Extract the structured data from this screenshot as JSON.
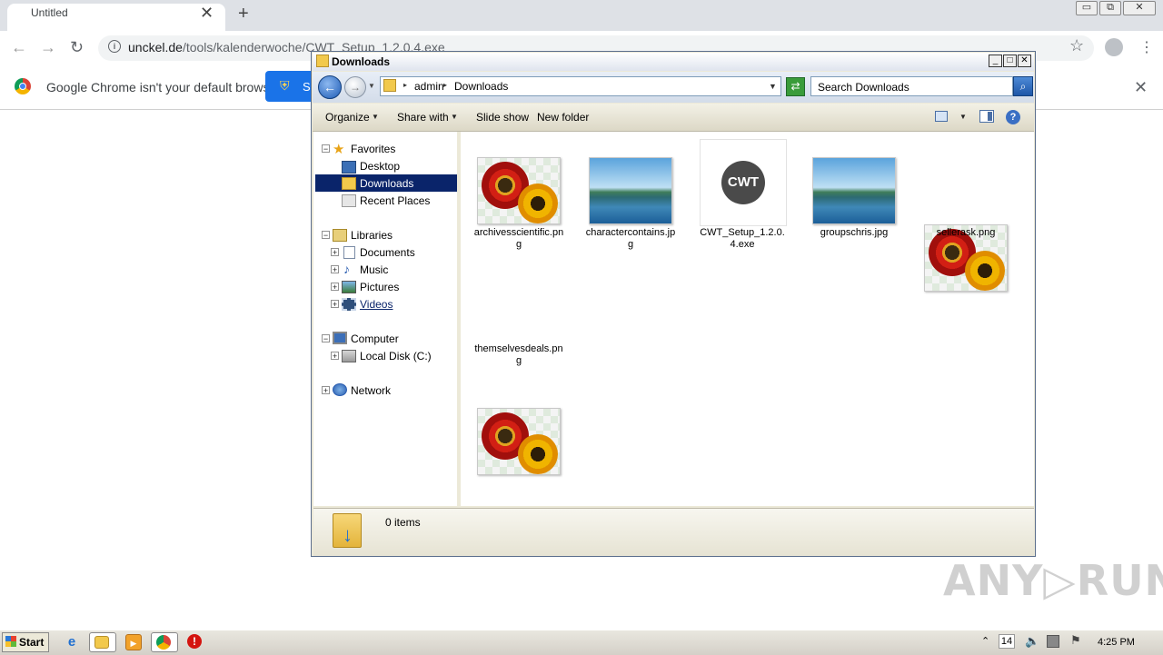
{
  "browser": {
    "tab_title": "Untitled",
    "tab_close": "✕",
    "new_tab": "+",
    "url_host": "unckel.de",
    "url_path": "/tools/kalenderwoche/CWT_Setup_1.2.0.4.exe",
    "infobar_text": "Google Chrome isn't your default browser",
    "infobar_button_partial": "S",
    "window_min": "▭",
    "window_max": "⧉",
    "window_close": "✕"
  },
  "explorer": {
    "title": "Downloads",
    "breadcrumb": [
      "admin",
      "Downloads"
    ],
    "search_placeholder": "Search Downloads",
    "commands": {
      "organize": "Organize",
      "share_with": "Share with",
      "slide_show": "Slide show",
      "new_folder": "New folder"
    },
    "nav": {
      "favorites": "Favorites",
      "desktop": "Desktop",
      "downloads": "Downloads",
      "recent_places": "Recent Places",
      "libraries": "Libraries",
      "documents": "Documents",
      "music": "Music",
      "pictures": "Pictures",
      "videos": "Videos",
      "computer": "Computer",
      "local_disk": "Local Disk (C:)",
      "network": "Network"
    },
    "files": [
      {
        "name": "archivesscientific.png",
        "kind": "flower"
      },
      {
        "name": "charactercontains.jpg",
        "kind": "landscape"
      },
      {
        "name": "CWT_Setup_1.2.0.4.exe",
        "kind": "cwt",
        "logo": "CWT"
      },
      {
        "name": "groupschris.jpg",
        "kind": "landscape"
      },
      {
        "name": "sellerask.png",
        "kind": "flower"
      },
      {
        "name": "themselvesdeals.png",
        "kind": "flower"
      }
    ],
    "details_text": "0 items"
  },
  "watermark": "ANY▷RUN",
  "taskbar": {
    "start_label": "Start",
    "lang": "14",
    "clock": "4:25 PM"
  },
  "colors": {
    "selection": "#0a246a",
    "chrome_blue": "#1a73e8"
  }
}
